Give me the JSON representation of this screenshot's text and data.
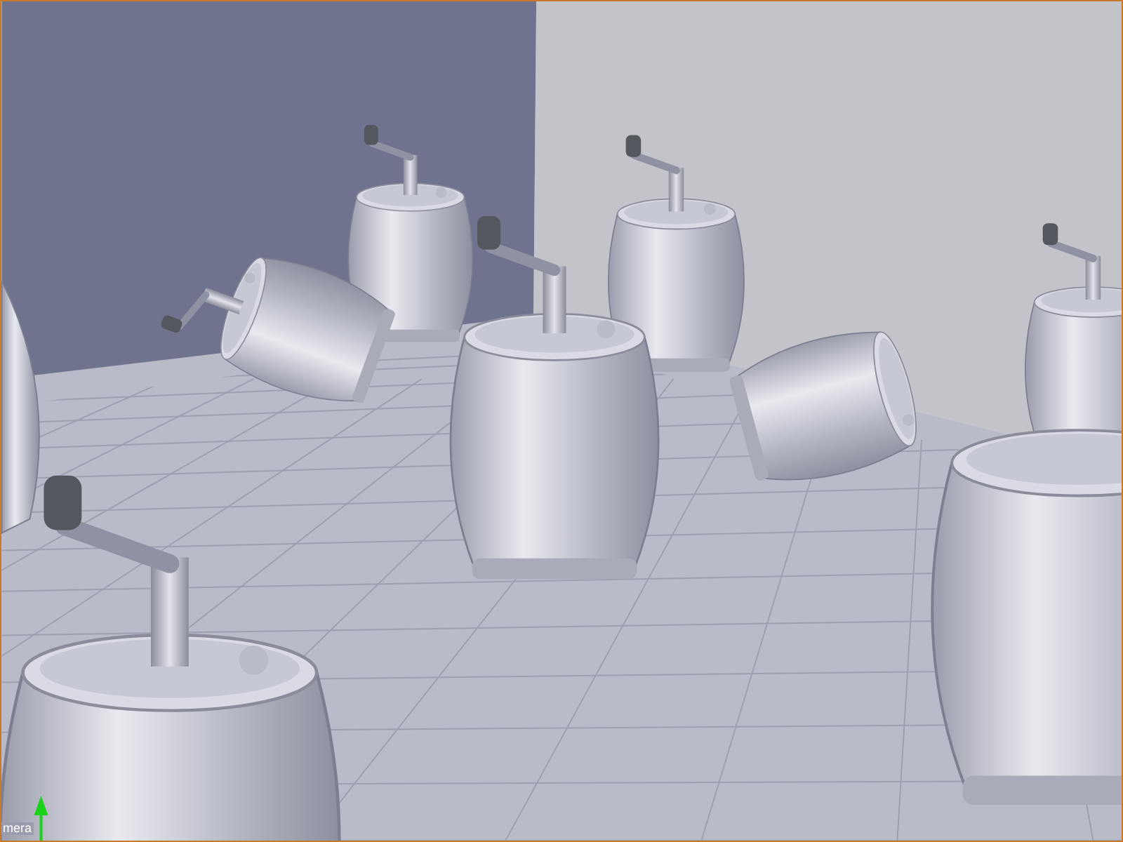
{
  "viewport": {
    "corner_label": "mera"
  }
}
